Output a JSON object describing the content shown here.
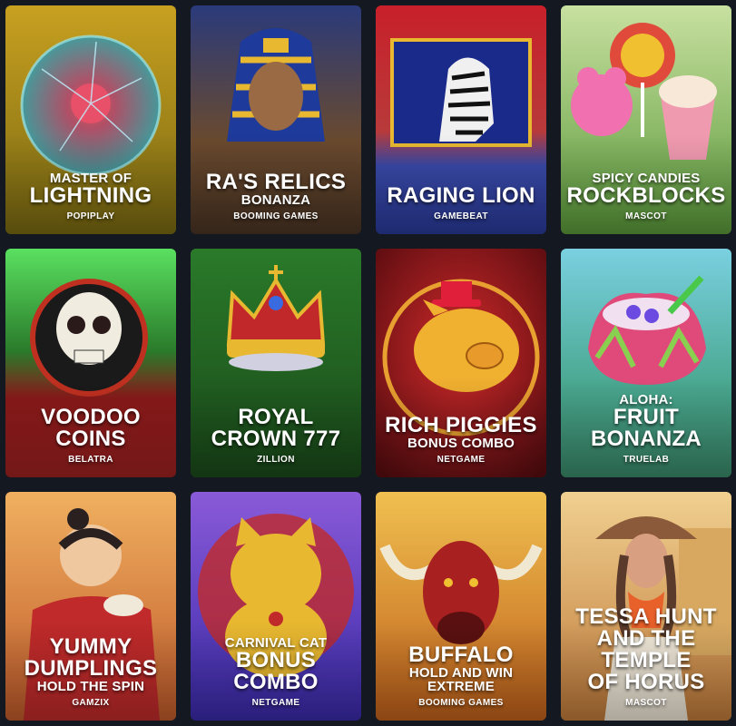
{
  "games": [
    {
      "pre": "MASTER OF",
      "title": "LIGHTNING",
      "sub": "",
      "provider": "POPIPLAY",
      "art": "plasma-ball-icon",
      "bg": [
        "#c8a020",
        "#7a6a12"
      ]
    },
    {
      "pre": "",
      "title": "RA'S RELICS",
      "sub": "BONANZA",
      "provider": "BOOMING GAMES",
      "art": "pharaoh-icon",
      "bg": [
        "#6a4a2e",
        "#3a2a1e"
      ]
    },
    {
      "pre": "",
      "title": "RAGING LION",
      "sub": "",
      "provider": "GAMEBEAT",
      "art": "zebra-icon",
      "bg": [
        "#c8202a",
        "#2a3a9a"
      ]
    },
    {
      "pre": "SPICY CANDIES",
      "title": "ROCKBLOCKS",
      "sub": "",
      "provider": "MASCOT",
      "art": "candy-icon",
      "bg": [
        "#9ac862",
        "#5a9a3a"
      ]
    },
    {
      "pre": "",
      "title": "VOODOO",
      "title2": "COINS",
      "sub": "",
      "provider": "BELATRA",
      "art": "skull-icon",
      "bg": [
        "#4ad050",
        "#9a2020"
      ]
    },
    {
      "pre": "",
      "title": "ROYAL",
      "title2": "CROWN 777",
      "sub": "",
      "provider": "ZILLION",
      "art": "crown-icon",
      "bg": [
        "#2a6a2a",
        "#1a4a1a"
      ]
    },
    {
      "pre": "",
      "title": "RICH PIGGIES",
      "sub": "BONUS COMBO",
      "provider": "NETGAME",
      "art": "pig-icon",
      "bg": [
        "#a0181c",
        "#5a0c10"
      ]
    },
    {
      "pre": "ALOHA:",
      "title": "FRUIT",
      "title2": "BONANZA",
      "sub": "",
      "provider": "TRUELAB",
      "art": "dragonfruit-icon",
      "bg": [
        "#5ab8c8",
        "#3a8a6a"
      ]
    },
    {
      "pre": "",
      "title": "YUMMY",
      "title2": "DUMPLINGS",
      "sub": "HOLD THE SPIN",
      "provider": "GAMZIX",
      "art": "chef-icon",
      "bg": [
        "#e89a4a",
        "#a03a2a"
      ]
    },
    {
      "pre": "CARNIVAL CAT",
      "title": "BONUS",
      "title2": "COMBO",
      "sub": "",
      "provider": "NETGAME",
      "art": "lucky-cat-icon",
      "bg": [
        "#7a4ac8",
        "#3a2a9a"
      ]
    },
    {
      "pre": "",
      "title": "BUFFALO",
      "sub": "HOLD AND WIN",
      "sub2": "EXTREME",
      "provider": "BOOMING GAMES",
      "art": "buffalo-icon",
      "bg": [
        "#e8a030",
        "#b85a1a"
      ]
    },
    {
      "pre": "",
      "title": "TESSA HUNT",
      "title2": "AND THE",
      "title3": "TEMPLE",
      "title4": "OF HORUS",
      "sub": "",
      "provider": "MASCOT",
      "art": "explorer-icon",
      "bg": [
        "#e8c080",
        "#c07a3a"
      ]
    }
  ]
}
